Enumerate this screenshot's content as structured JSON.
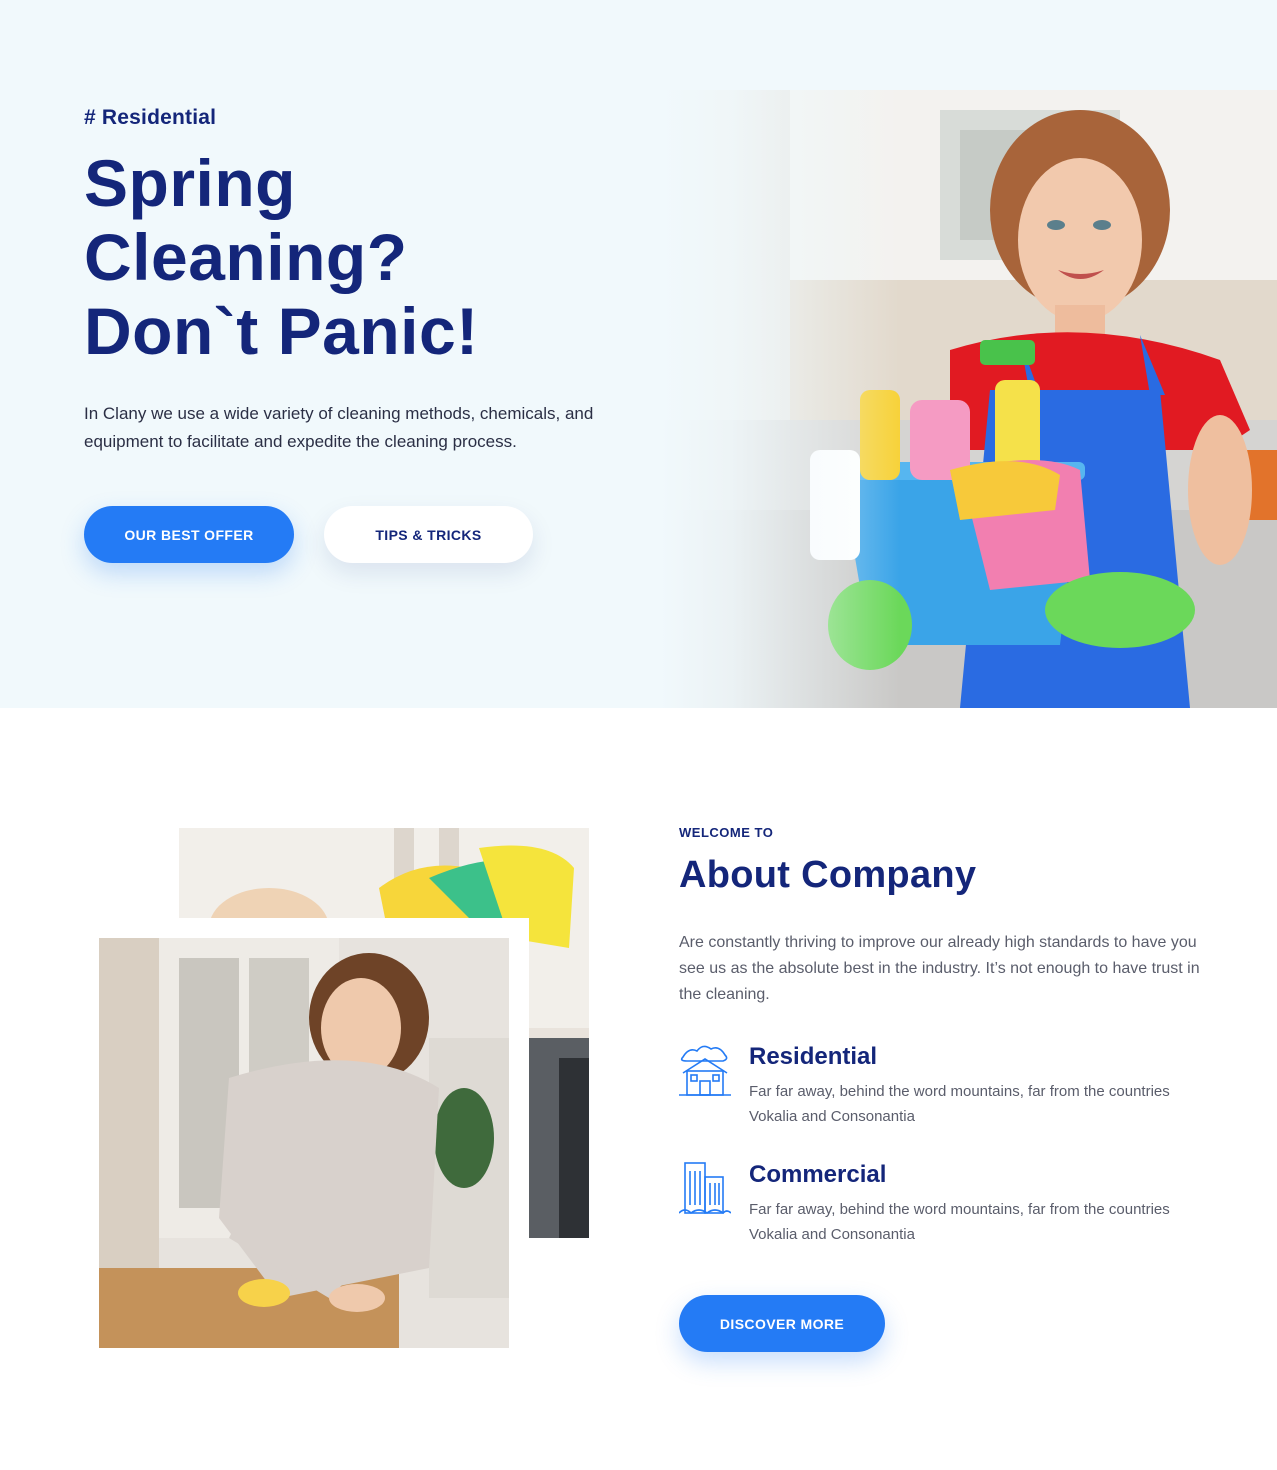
{
  "hero": {
    "tag": "# Residential",
    "title_lines": [
      "Spring",
      "Cleaning?",
      "Don`t Panic!"
    ],
    "description": "In Clany we use a wide variety of cleaning methods, chemicals, and equipment to facilitate and expedite the cleaning process.",
    "primary_button": "OUR BEST OFFER",
    "secondary_button": "TIPS & TRICKS"
  },
  "about": {
    "kicker": "WELCOME TO",
    "title": "About Company",
    "description": "Are constantly thriving to improve our already high standards to have you see us as the absolute best in the industry. It’s not enough to have trust in the cleaning.",
    "features": [
      {
        "icon": "house-icon",
        "title": "Residential",
        "text": "Far far away, behind the word mountains, far from the countries Vokalia and Consonantia"
      },
      {
        "icon": "buildings-icon",
        "title": "Commercial",
        "text": "Far far away, behind the word mountains, far from the countries Vokalia and Consonantia"
      }
    ],
    "button": "DISCOVER MORE"
  },
  "colors": {
    "navy": "#14267a",
    "accent_blue": "#247bf5",
    "hero_bg": "#f1f9fc",
    "body_text": "#5a5d6b"
  }
}
